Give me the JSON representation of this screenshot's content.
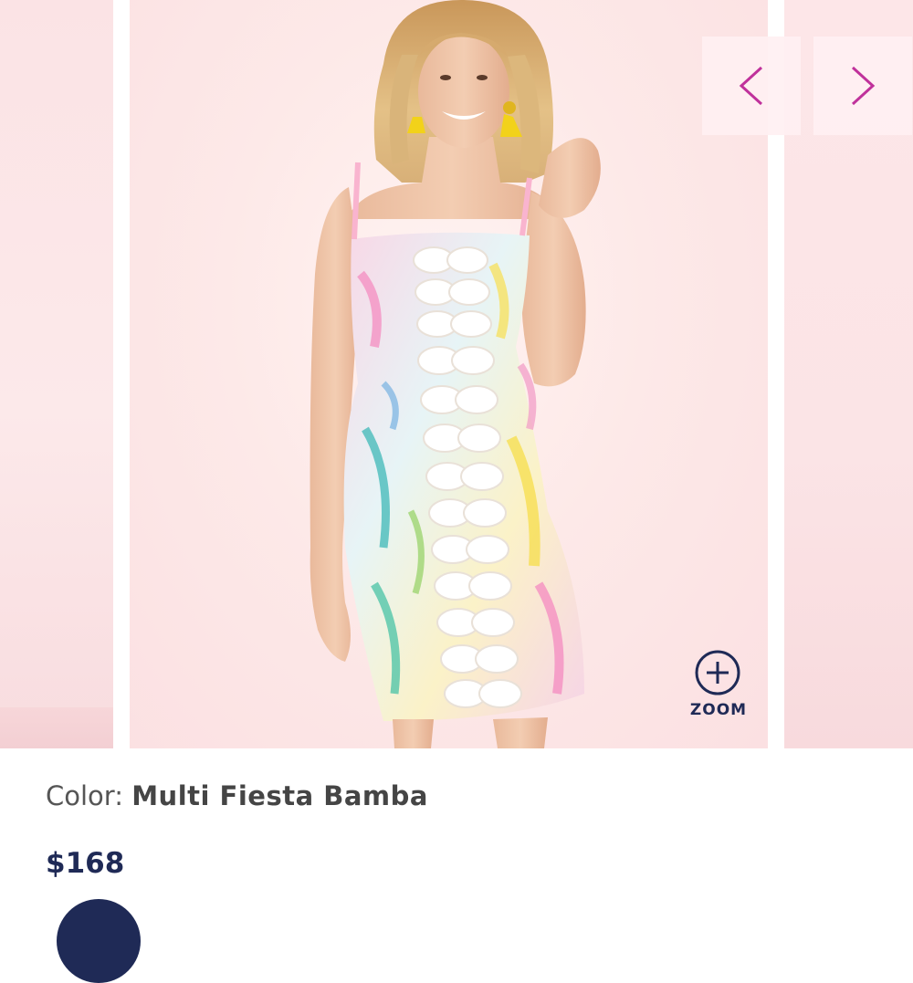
{
  "gallery": {
    "zoom_label": "ZOOM",
    "nav_prev_icon": "chevron-left-icon",
    "nav_next_icon": "chevron-right-icon",
    "zoom_icon": "plus-circle-icon",
    "arrow_color": "#c0319b"
  },
  "product": {
    "color_label": "Color:",
    "color_value": "Multi Fiesta Bamba",
    "price": "$168"
  },
  "colors": {
    "navy": "#1f2a56",
    "background_pink": "#fbe9ea"
  }
}
